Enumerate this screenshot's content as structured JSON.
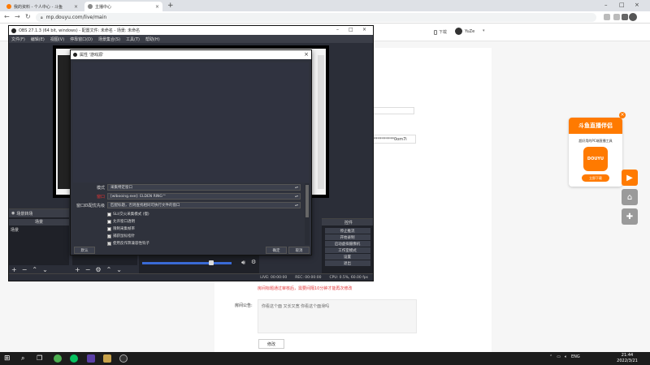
{
  "browser": {
    "tabs": [
      {
        "title": "我的资料 - 个人中心 - 斗鱼",
        "active": false
      },
      {
        "title": "主播中心",
        "active": true
      }
    ],
    "new_tab": "+",
    "url": "mp.douyu.com/live/main"
  },
  "page": {
    "header": {
      "download": "下载",
      "username": "YuZe"
    },
    "key_text": "**********0om7i",
    "warning": "房间标题通过审核后，需要间隔10分钟才能再次修改",
    "notice_label": "房间公告:",
    "notice_text": "你看这个面 又长又宽 你看这个面滑吗",
    "modify_button": "修改",
    "promo": {
      "title": "斗鱼直播伴侣",
      "subtitle": "超好用的PC端直播工具",
      "logo_text": "DOUYU",
      "button": "立即下载",
      "close": "×"
    }
  },
  "obs": {
    "title": "OBS 27.1.3 (64 bit, windows) - 配置文件: 未命名 - 场景: 未命名",
    "menus": [
      "文件(F)",
      "编辑(E)",
      "视图(V)",
      "停靠窗口(D)",
      "场景集合(S)",
      "工具(T)",
      "帮助(H)"
    ],
    "docks": {
      "scenes": {
        "title": "场景",
        "items": [
          "场景"
        ]
      },
      "sources": {
        "title": "来源"
      },
      "mixer": {
        "title": "音频混音器"
      },
      "transitions": {
        "title": "场景转场"
      },
      "controls": {
        "title": "控件",
        "buttons": [
          "停止推流",
          "开始录制",
          "启动虚拟摄像机",
          "工作室模式",
          "设置",
          "退出"
        ]
      }
    },
    "status": [
      "LIVE: 00:00:00",
      "REC: 00:00:00",
      "CPU: 0.5%, 60.00 fps"
    ],
    "properties": {
      "title": "属性 '游戏源'",
      "rows": [
        {
          "label": "模式",
          "value": "采集特定窗口",
          "warn": false
        },
        {
          "label": "窗口",
          "value": "[wlbooing.exe]: ELDEN RING™",
          "warn": true
        },
        {
          "label": "窗口匹配优先级",
          "value": "匹配标题，否则查找相同可执行文件的窗口",
          "warn": false
        }
      ],
      "checks": [
        {
          "label": "SLI/交火采集模式 (慢)",
          "checked": false
        },
        {
          "label": "允许窗口透明",
          "checked": false
        },
        {
          "label": "限制采集帧率",
          "checked": false
        },
        {
          "label": "捕获鼠标指针",
          "checked": true
        },
        {
          "label": "使用反作弊兼容性钩子",
          "checked": true
        }
      ],
      "defaults_button": "默认",
      "ok_button": "确定",
      "cancel_button": "取消"
    }
  },
  "taskbar": {
    "tray_lang": "ENG",
    "time": "21:44",
    "date": "2022/3/21"
  },
  "colors": {
    "douyu_orange": "#ff7a00",
    "warning_red": "#e4393c",
    "obs_bg": "#2b2e38"
  }
}
